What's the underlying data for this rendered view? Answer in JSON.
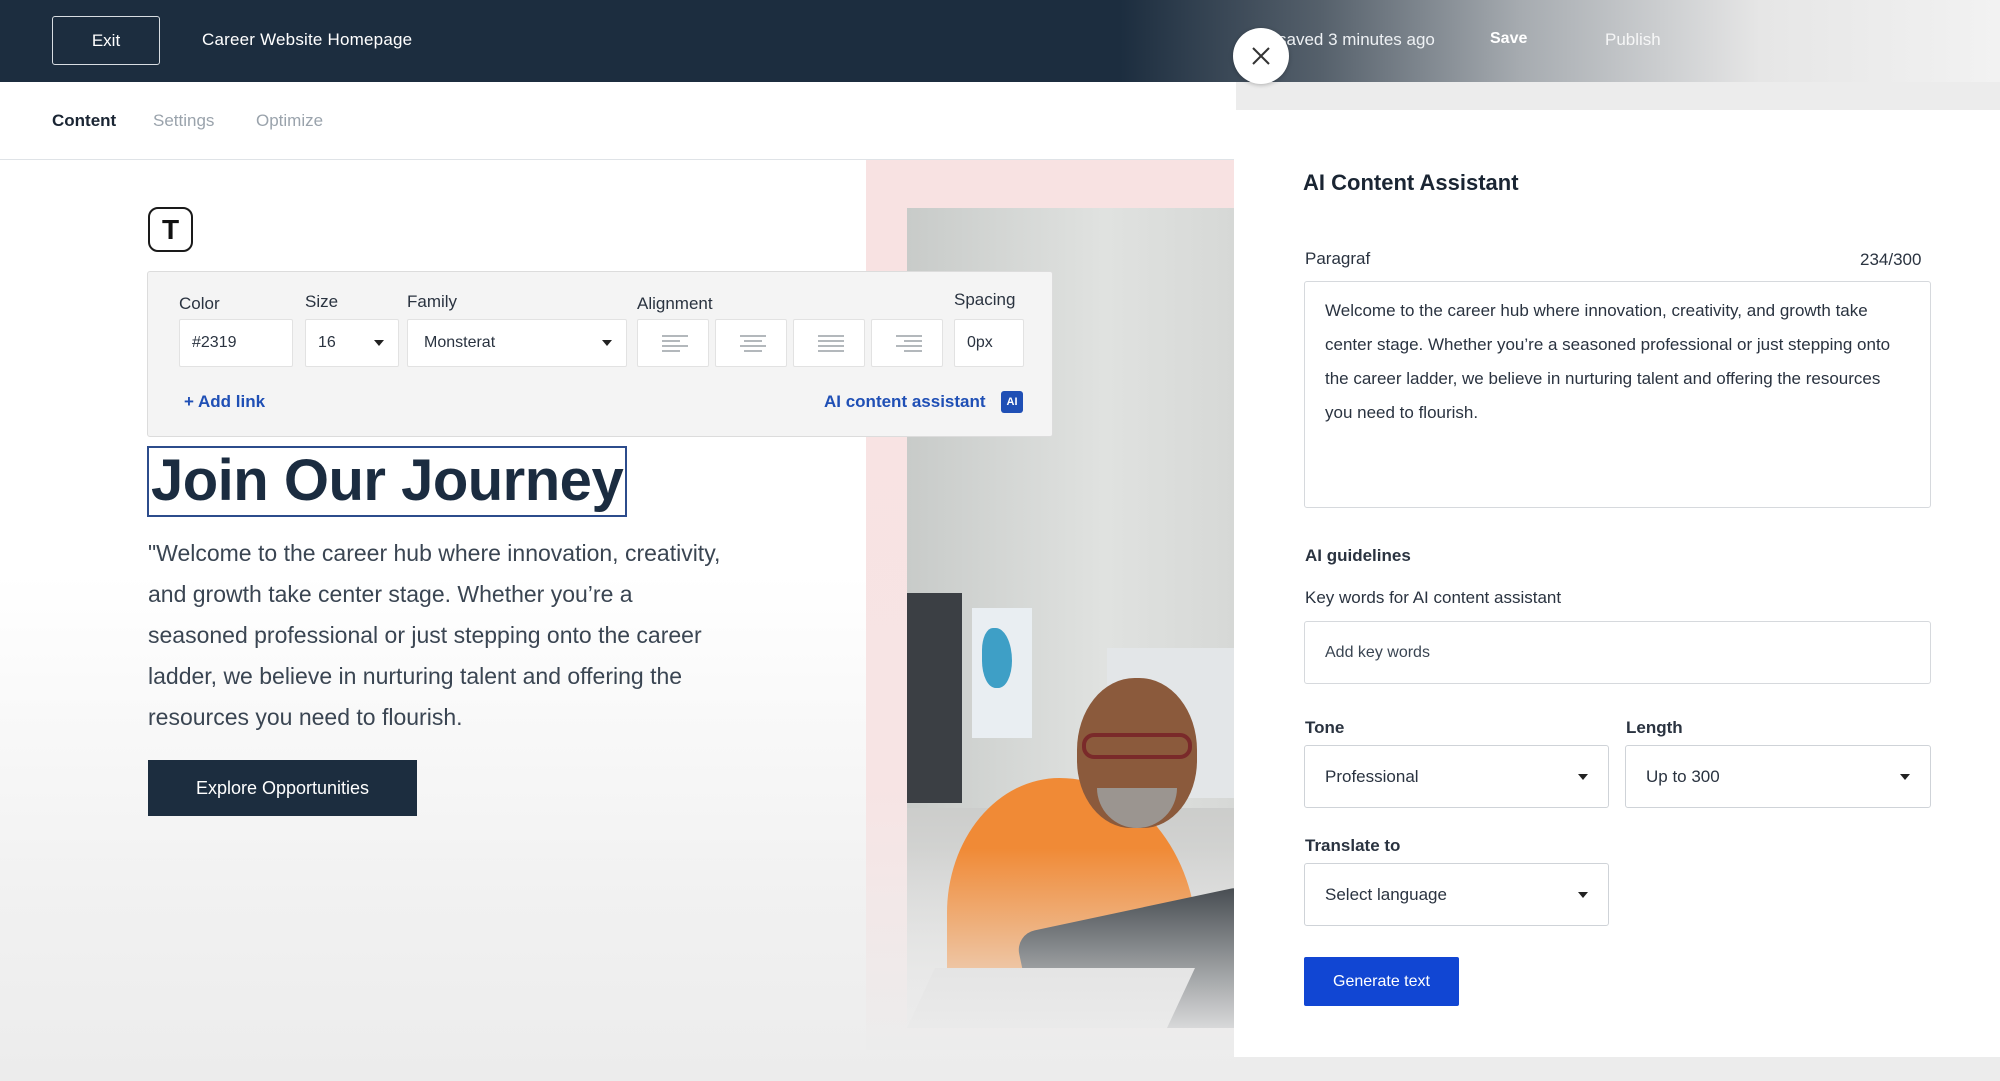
{
  "header": {
    "exit_label": "Exit",
    "page_name": "Career Website Homepage",
    "saved_status": "saved 3 minutes ago",
    "save_label": "Save",
    "publish_label": "Publish"
  },
  "tabs": [
    {
      "label": "Content",
      "active": true
    },
    {
      "label": "Settings",
      "active": false
    },
    {
      "label": "Optimize",
      "active": false
    }
  ],
  "text_block_icon": "T",
  "toolbar": {
    "color_label": "Color",
    "color_value": "#2319",
    "size_label": "Size",
    "size_value": "16",
    "family_label": "Family",
    "family_value": "Monsterat",
    "alignment_label": "Alignment",
    "alignment_options": [
      "align-left",
      "align-center",
      "align-justify",
      "align-right"
    ],
    "spacing_label": "Spacing",
    "spacing_value": "0px",
    "add_link_label": "+ Add link",
    "ai_assistant_label": "AI content assistant",
    "ai_badge": "AI"
  },
  "hero": {
    "headline": "Join Our Journey",
    "paragraph": "\"Welcome to the career hub where innovation, creativity, and growth take center stage. Whether you’re a seasoned professional or just stepping onto the career ladder, we believe in nurturing talent and offering the resources you need to flourish.",
    "cta_label": "Explore Opportunities"
  },
  "assistant": {
    "title": "AI Content Assistant",
    "paragraph_label": "Paragraf",
    "char_counter": "234/300",
    "paragraph_text": "Welcome to the career hub where innovation, creativity, and growth take center stage. Whether you’re a seasoned professional or just stepping onto the career ladder, we believe in nurturing talent and offering the resources you need to flourish.",
    "guidelines_heading": "AI guidelines",
    "keywords_label": "Key words for AI content assistant",
    "keywords_placeholder": "Add key words",
    "tone_label": "Tone",
    "tone_value": "Professional",
    "length_label": "Length",
    "length_value": "Up to 300",
    "translate_label": "Translate to",
    "translate_value": "Select language",
    "generate_label": "Generate text"
  },
  "colors": {
    "header_bg": "#1c2d3f",
    "accent_blue": "#1146d3",
    "link_blue": "#1f4fb5",
    "cta_bg": "#1c2d3f"
  }
}
